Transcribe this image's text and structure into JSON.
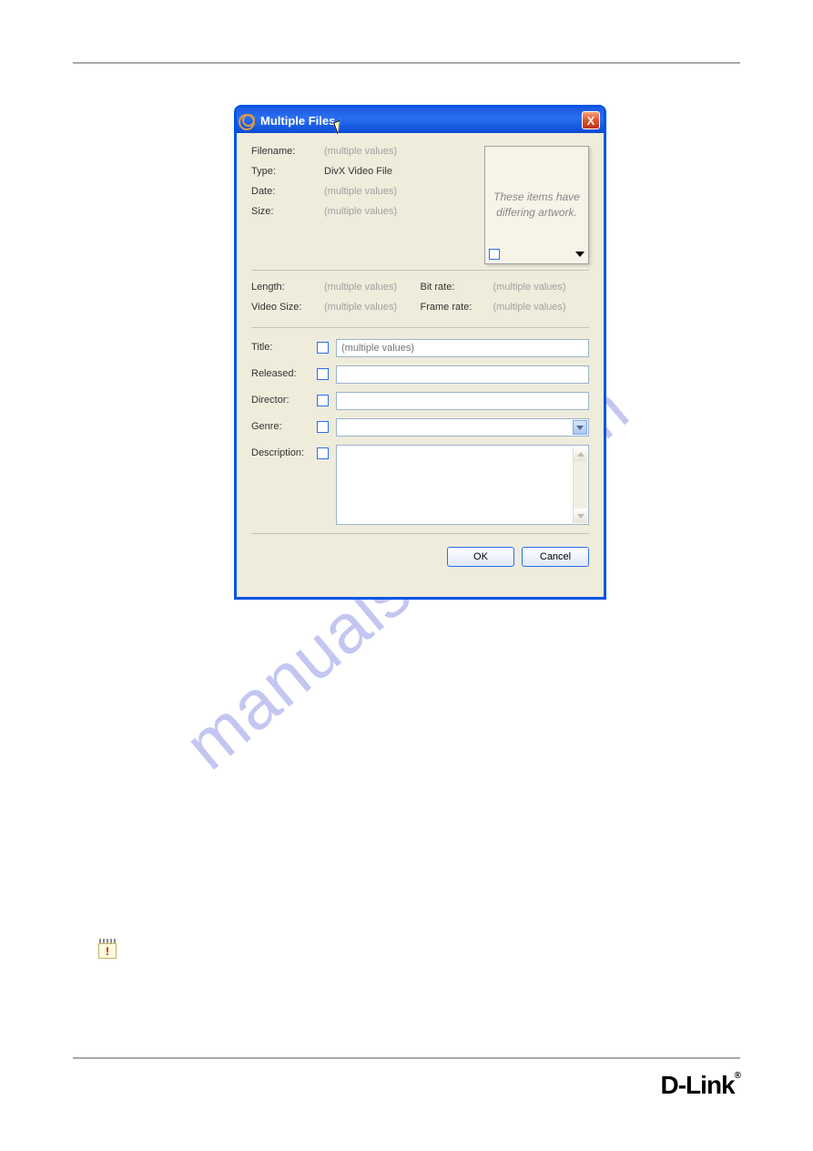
{
  "page": {
    "logo_text": "D-Link",
    "alert_glyph": "!"
  },
  "dialog": {
    "title": "Multiple Files",
    "close_glyph": "X",
    "info": {
      "filename_label": "Filename:",
      "filename_value": "(multiple values)",
      "type_label": "Type:",
      "type_value": "DivX Video File",
      "date_label": "Date:",
      "date_value": "(multiple values)",
      "size_label": "Size:",
      "size_value": "(multiple values)"
    },
    "artwork_text": "These items have differing artwork.",
    "media": {
      "length_label": "Length:",
      "length_value": "(multiple values)",
      "bitrate_label": "Bit rate:",
      "bitrate_value": "(multiple values)",
      "videosize_label": "Video Size:",
      "videosize_value": "(multiple values)",
      "framerate_label": "Frame rate:",
      "framerate_value": "(multiple values)"
    },
    "fields": {
      "title_label": "Title:",
      "title_placeholder": "(multiple values)",
      "released_label": "Released:",
      "director_label": "Director:",
      "genre_label": "Genre:",
      "description_label": "Description:"
    },
    "buttons": {
      "ok": "OK",
      "cancel": "Cancel"
    }
  },
  "watermark": "manualshive.com"
}
